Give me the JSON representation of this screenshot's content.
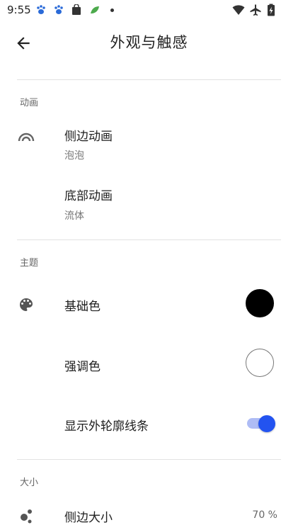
{
  "status_bar": {
    "time": "9:55"
  },
  "header": {
    "title": "外观与触感"
  },
  "sections": {
    "animation": {
      "label": "动画",
      "items": [
        {
          "title": "侧边动画",
          "subtitle": "泡泡"
        },
        {
          "title": "底部动画",
          "subtitle": "流体"
        }
      ]
    },
    "theme": {
      "label": "主题",
      "items": [
        {
          "title": "基础色",
          "color": "#000000"
        },
        {
          "title": "强调色",
          "color": "#ffffff"
        },
        {
          "title": "显示外轮廓线条",
          "enabled": true
        }
      ]
    },
    "size": {
      "label": "大小",
      "items": [
        {
          "title": "侧边大小",
          "value": "70 %"
        }
      ]
    }
  },
  "colors": {
    "accent": "#2353f0",
    "accent_track": "#aebcf5"
  }
}
